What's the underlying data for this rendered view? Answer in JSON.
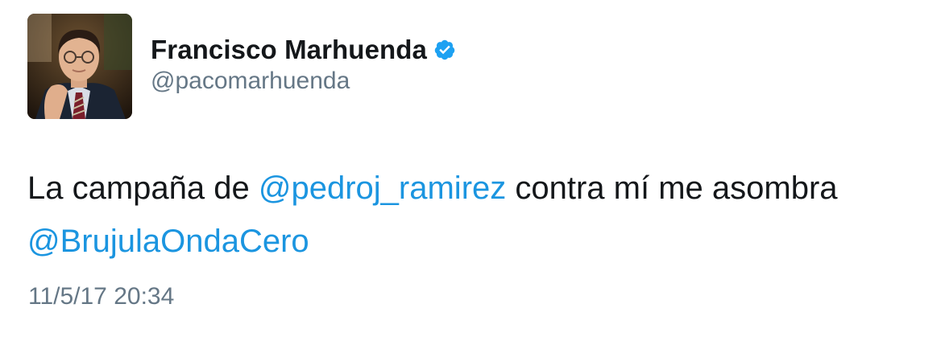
{
  "author": {
    "display_name": "Francisco Marhuenda",
    "handle": "@pacomarhuenda",
    "verified_icon": "verified-badge-icon",
    "avatar_icon": "profile-photo"
  },
  "tweet": {
    "line1_prefix": "La campaña de ",
    "line1_mention": "@pedroj_ramirez",
    "line1_suffix": " contra mí me asombra",
    "line2_mention": "@BrujulaOndaCero"
  },
  "timestamp": "11/5/17 20:34",
  "colors": {
    "link": "#1b95e0",
    "text": "#14171a",
    "secondary": "#657786",
    "verified": "#1da1f2"
  }
}
